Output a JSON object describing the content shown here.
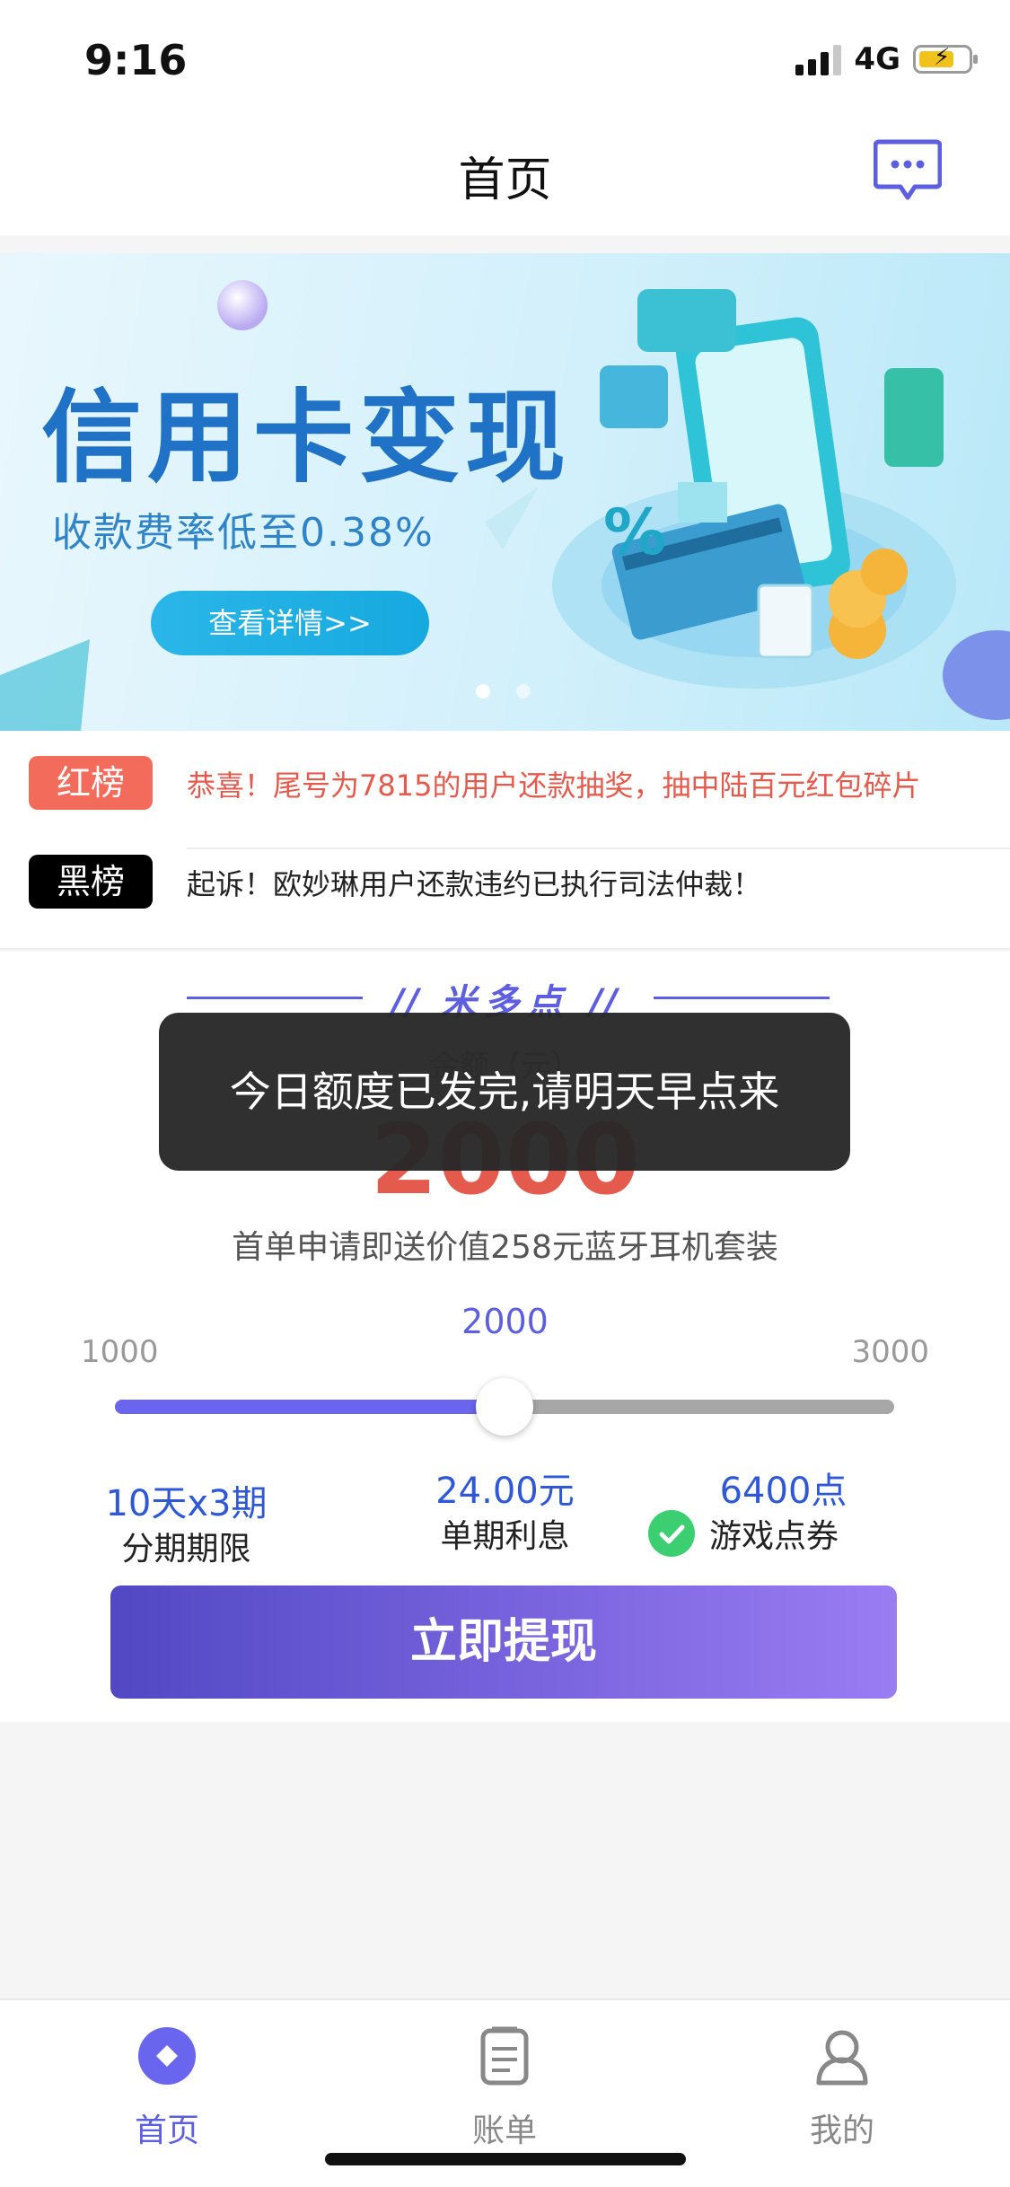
{
  "status_bar": {
    "time": "9:16",
    "network": "4G"
  },
  "header": {
    "title": "首页",
    "message_icon": "message-icon"
  },
  "banner": {
    "title": "信用卡变现",
    "subtitle": "收款费率低至0.38%",
    "button_label": "查看详情>>",
    "page_count": 2,
    "active_page": 1
  },
  "notices": [
    {
      "tag": "红榜",
      "text": "恭喜！尾号为7815的用户还款抽奖，抽中陆百元红包碎片",
      "tag_color": "#f36b5b",
      "text_color": "#e45a4c"
    },
    {
      "tag": "黑榜",
      "text": "起诉！欧妙琳用户还款违约已执行司法仲裁！",
      "tag_color": "#000000",
      "text_color": "#222222"
    }
  ],
  "loan": {
    "brand": "米多点",
    "amount_label": "金额（元）",
    "amount": "2000",
    "promo": "首单申请即送价值258元蓝牙耳机套装",
    "slider": {
      "current": "2000",
      "min": "1000",
      "max": "3000",
      "value": 2000,
      "min_value": 1000,
      "max_value": 3000
    },
    "stats": [
      {
        "value": "10天x3期",
        "label": "分期期限"
      },
      {
        "value": "24.00元",
        "label": "单期利息"
      },
      {
        "value": "6400点",
        "label": "游戏点券"
      }
    ],
    "cta_label": "立即提现"
  },
  "toast": {
    "message": "今日额度已发完,请明天早点来"
  },
  "tabbar": {
    "items": [
      {
        "label": "首页",
        "icon": "home-icon",
        "active": true
      },
      {
        "label": "账单",
        "icon": "bill-icon",
        "active": false
      },
      {
        "label": "我的",
        "icon": "profile-icon",
        "active": false
      }
    ]
  },
  "colors": {
    "accent": "#5d5fe0",
    "amount": "#e45a4c",
    "stat_value": "#2f58d6",
    "cta_start": "#5248c4",
    "cta_end": "#9a7cf3",
    "check": "#3ccf71"
  }
}
